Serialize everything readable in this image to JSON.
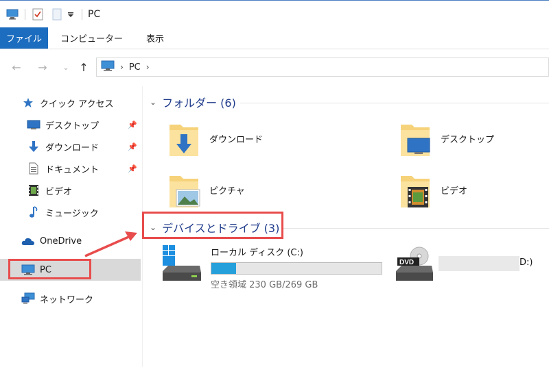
{
  "window": {
    "title": "PC"
  },
  "ribbon": {
    "tabs": [
      "ファイル",
      "コンピューター",
      "表示"
    ]
  },
  "address": {
    "path": [
      "PC"
    ]
  },
  "sidebar": {
    "items": [
      {
        "label": "クイック アクセス",
        "icon": "star-icon"
      },
      {
        "label": "デスクトップ",
        "icon": "desktop-icon",
        "pinned": true
      },
      {
        "label": "ダウンロード",
        "icon": "download-icon",
        "pinned": true
      },
      {
        "label": "ドキュメント",
        "icon": "document-icon",
        "pinned": true
      },
      {
        "label": "ビデオ",
        "icon": "video-icon"
      },
      {
        "label": "ミュージック",
        "icon": "music-icon"
      },
      {
        "label": "OneDrive",
        "icon": "cloud-icon"
      },
      {
        "label": "PC",
        "icon": "computer-icon",
        "selected": true
      },
      {
        "label": "ネットワーク",
        "icon": "network-icon"
      }
    ]
  },
  "folders_section": {
    "title": "フォルダー (6)",
    "folders": [
      {
        "label": "ダウンロード",
        "icon": "download-folder-icon"
      },
      {
        "label": "デスクトップ",
        "icon": "desktop-folder-icon"
      },
      {
        "label": "ピクチャ",
        "icon": "pictures-folder-icon"
      },
      {
        "label": "ビデオ",
        "icon": "video-folder-icon"
      }
    ]
  },
  "devices_section": {
    "title": "デバイスとドライブ (3)",
    "drives": [
      {
        "name": "ローカル ディスク (C:)",
        "space": "空き領域 230 GB/269 GB",
        "used_fraction": 0.145,
        "icon": "windows-drive-icon"
      },
      {
        "name": "D:)",
        "icon": "dvd-drive-icon",
        "badge": "DVD"
      }
    ]
  },
  "colors": {
    "accent": "#1c6cbf",
    "annotation": "#e84c4c",
    "usage_bar": "#26a0da",
    "section_text": "#1e3a8a"
  }
}
